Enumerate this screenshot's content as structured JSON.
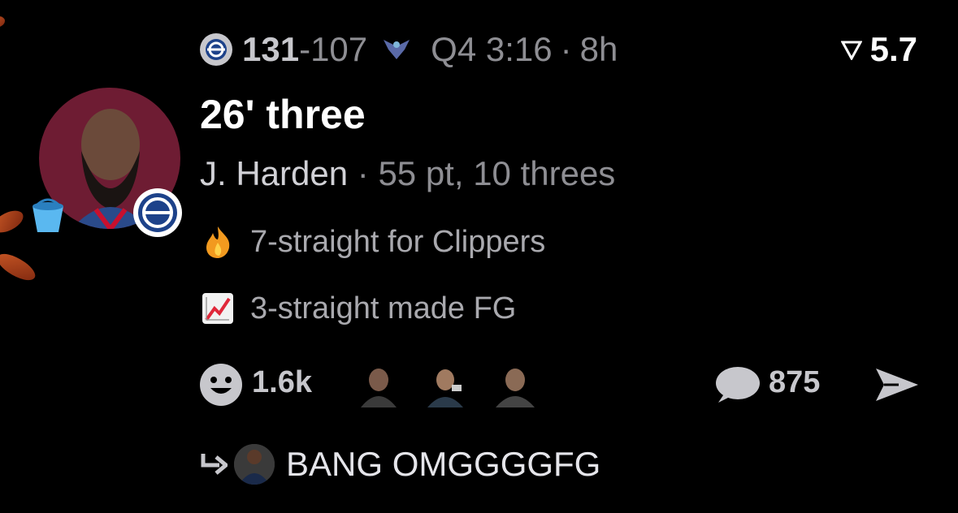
{
  "header": {
    "score_home": "131",
    "score_away": "107",
    "clock": "Q4 3:16",
    "separator": "·",
    "age": "8h",
    "rating": "5.7"
  },
  "play": {
    "title": "26' three",
    "player": "J. Harden",
    "separator": "·",
    "player_stats": "55 pt, 10 threes"
  },
  "streaks": [
    {
      "icon": "fire-emoji",
      "text": "7-straight for Clippers"
    },
    {
      "icon": "chart-up-emoji",
      "text": "3-straight made FG"
    }
  ],
  "actions": {
    "reactions": "1.6k",
    "comments": "875"
  },
  "reply": {
    "text": "BANG OMGGGGFG"
  },
  "colors": {
    "background": "#000000",
    "avatar_bg": "#6e1c33",
    "muted_text": "#8e8e93"
  }
}
